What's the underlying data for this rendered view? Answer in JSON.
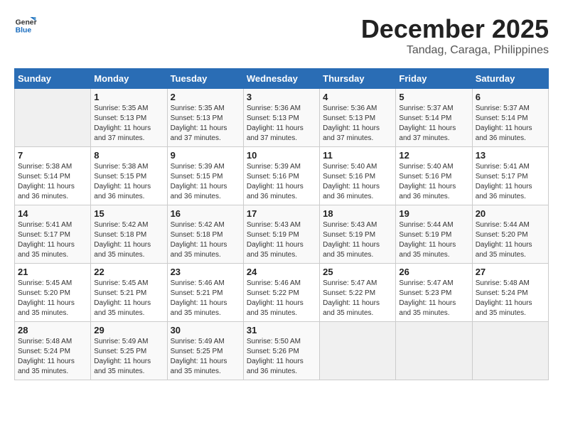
{
  "logo": {
    "line1": "General",
    "line2": "Blue"
  },
  "title": "December 2025",
  "location": "Tandag, Caraga, Philippines",
  "header": {
    "days": [
      "Sunday",
      "Monday",
      "Tuesday",
      "Wednesday",
      "Thursday",
      "Friday",
      "Saturday"
    ]
  },
  "weeks": [
    [
      {
        "num": "",
        "info": ""
      },
      {
        "num": "1",
        "info": "Sunrise: 5:35 AM\nSunset: 5:13 PM\nDaylight: 11 hours\nand 37 minutes."
      },
      {
        "num": "2",
        "info": "Sunrise: 5:35 AM\nSunset: 5:13 PM\nDaylight: 11 hours\nand 37 minutes."
      },
      {
        "num": "3",
        "info": "Sunrise: 5:36 AM\nSunset: 5:13 PM\nDaylight: 11 hours\nand 37 minutes."
      },
      {
        "num": "4",
        "info": "Sunrise: 5:36 AM\nSunset: 5:13 PM\nDaylight: 11 hours\nand 37 minutes."
      },
      {
        "num": "5",
        "info": "Sunrise: 5:37 AM\nSunset: 5:14 PM\nDaylight: 11 hours\nand 37 minutes."
      },
      {
        "num": "6",
        "info": "Sunrise: 5:37 AM\nSunset: 5:14 PM\nDaylight: 11 hours\nand 36 minutes."
      }
    ],
    [
      {
        "num": "7",
        "info": "Sunrise: 5:38 AM\nSunset: 5:14 PM\nDaylight: 11 hours\nand 36 minutes."
      },
      {
        "num": "8",
        "info": "Sunrise: 5:38 AM\nSunset: 5:15 PM\nDaylight: 11 hours\nand 36 minutes."
      },
      {
        "num": "9",
        "info": "Sunrise: 5:39 AM\nSunset: 5:15 PM\nDaylight: 11 hours\nand 36 minutes."
      },
      {
        "num": "10",
        "info": "Sunrise: 5:39 AM\nSunset: 5:16 PM\nDaylight: 11 hours\nand 36 minutes."
      },
      {
        "num": "11",
        "info": "Sunrise: 5:40 AM\nSunset: 5:16 PM\nDaylight: 11 hours\nand 36 minutes."
      },
      {
        "num": "12",
        "info": "Sunrise: 5:40 AM\nSunset: 5:16 PM\nDaylight: 11 hours\nand 36 minutes."
      },
      {
        "num": "13",
        "info": "Sunrise: 5:41 AM\nSunset: 5:17 PM\nDaylight: 11 hours\nand 36 minutes."
      }
    ],
    [
      {
        "num": "14",
        "info": "Sunrise: 5:41 AM\nSunset: 5:17 PM\nDaylight: 11 hours\nand 35 minutes."
      },
      {
        "num": "15",
        "info": "Sunrise: 5:42 AM\nSunset: 5:18 PM\nDaylight: 11 hours\nand 35 minutes."
      },
      {
        "num": "16",
        "info": "Sunrise: 5:42 AM\nSunset: 5:18 PM\nDaylight: 11 hours\nand 35 minutes."
      },
      {
        "num": "17",
        "info": "Sunrise: 5:43 AM\nSunset: 5:19 PM\nDaylight: 11 hours\nand 35 minutes."
      },
      {
        "num": "18",
        "info": "Sunrise: 5:43 AM\nSunset: 5:19 PM\nDaylight: 11 hours\nand 35 minutes."
      },
      {
        "num": "19",
        "info": "Sunrise: 5:44 AM\nSunset: 5:19 PM\nDaylight: 11 hours\nand 35 minutes."
      },
      {
        "num": "20",
        "info": "Sunrise: 5:44 AM\nSunset: 5:20 PM\nDaylight: 11 hours\nand 35 minutes."
      }
    ],
    [
      {
        "num": "21",
        "info": "Sunrise: 5:45 AM\nSunset: 5:20 PM\nDaylight: 11 hours\nand 35 minutes."
      },
      {
        "num": "22",
        "info": "Sunrise: 5:45 AM\nSunset: 5:21 PM\nDaylight: 11 hours\nand 35 minutes."
      },
      {
        "num": "23",
        "info": "Sunrise: 5:46 AM\nSunset: 5:21 PM\nDaylight: 11 hours\nand 35 minutes."
      },
      {
        "num": "24",
        "info": "Sunrise: 5:46 AM\nSunset: 5:22 PM\nDaylight: 11 hours\nand 35 minutes."
      },
      {
        "num": "25",
        "info": "Sunrise: 5:47 AM\nSunset: 5:22 PM\nDaylight: 11 hours\nand 35 minutes."
      },
      {
        "num": "26",
        "info": "Sunrise: 5:47 AM\nSunset: 5:23 PM\nDaylight: 11 hours\nand 35 minutes."
      },
      {
        "num": "27",
        "info": "Sunrise: 5:48 AM\nSunset: 5:24 PM\nDaylight: 11 hours\nand 35 minutes."
      }
    ],
    [
      {
        "num": "28",
        "info": "Sunrise: 5:48 AM\nSunset: 5:24 PM\nDaylight: 11 hours\nand 35 minutes."
      },
      {
        "num": "29",
        "info": "Sunrise: 5:49 AM\nSunset: 5:25 PM\nDaylight: 11 hours\nand 35 minutes."
      },
      {
        "num": "30",
        "info": "Sunrise: 5:49 AM\nSunset: 5:25 PM\nDaylight: 11 hours\nand 35 minutes."
      },
      {
        "num": "31",
        "info": "Sunrise: 5:50 AM\nSunset: 5:26 PM\nDaylight: 11 hours\nand 36 minutes."
      },
      {
        "num": "",
        "info": ""
      },
      {
        "num": "",
        "info": ""
      },
      {
        "num": "",
        "info": ""
      }
    ]
  ]
}
